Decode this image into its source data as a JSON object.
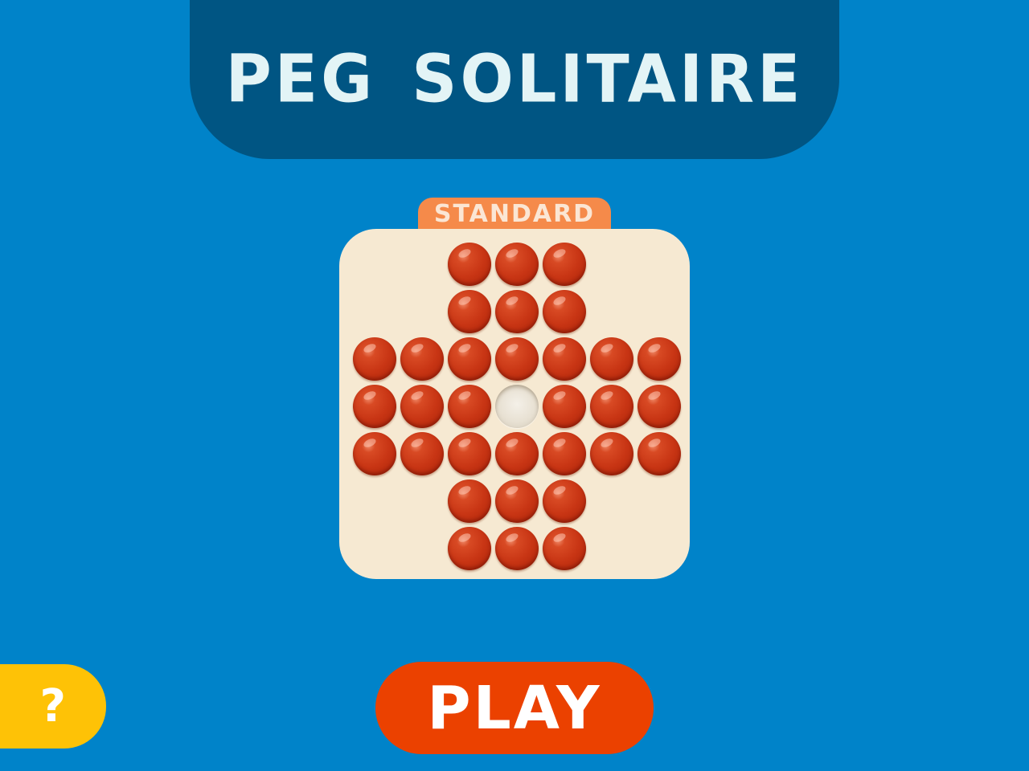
{
  "header": {
    "title": "PEG SOLITAIRE"
  },
  "board_selector": {
    "mode_label": "STANDARD",
    "layout": "english-cross",
    "grid_size": 7,
    "rows": [
      "..XXX..",
      "..XXX..",
      "XXXXXXX",
      "XXX.XXX",
      "XXXXXXX",
      "..XXX..",
      "..XXX.."
    ],
    "legend": {
      "X": "peg",
      ".": "empty-hole-or-none"
    },
    "empty_hole": {
      "row": 3,
      "col": 3
    },
    "peg_count": 32
  },
  "buttons": {
    "help_label": "?",
    "play_label": "PLAY"
  },
  "colors": {
    "background": "#0083c9",
    "title_banner": "#005583",
    "title_text": "#e3f4f6",
    "mode_tab": "#f58a4a",
    "board": "#f6e9d2",
    "peg": "#c83514",
    "help_button": "#fec206",
    "play_button": "#eb4100"
  }
}
